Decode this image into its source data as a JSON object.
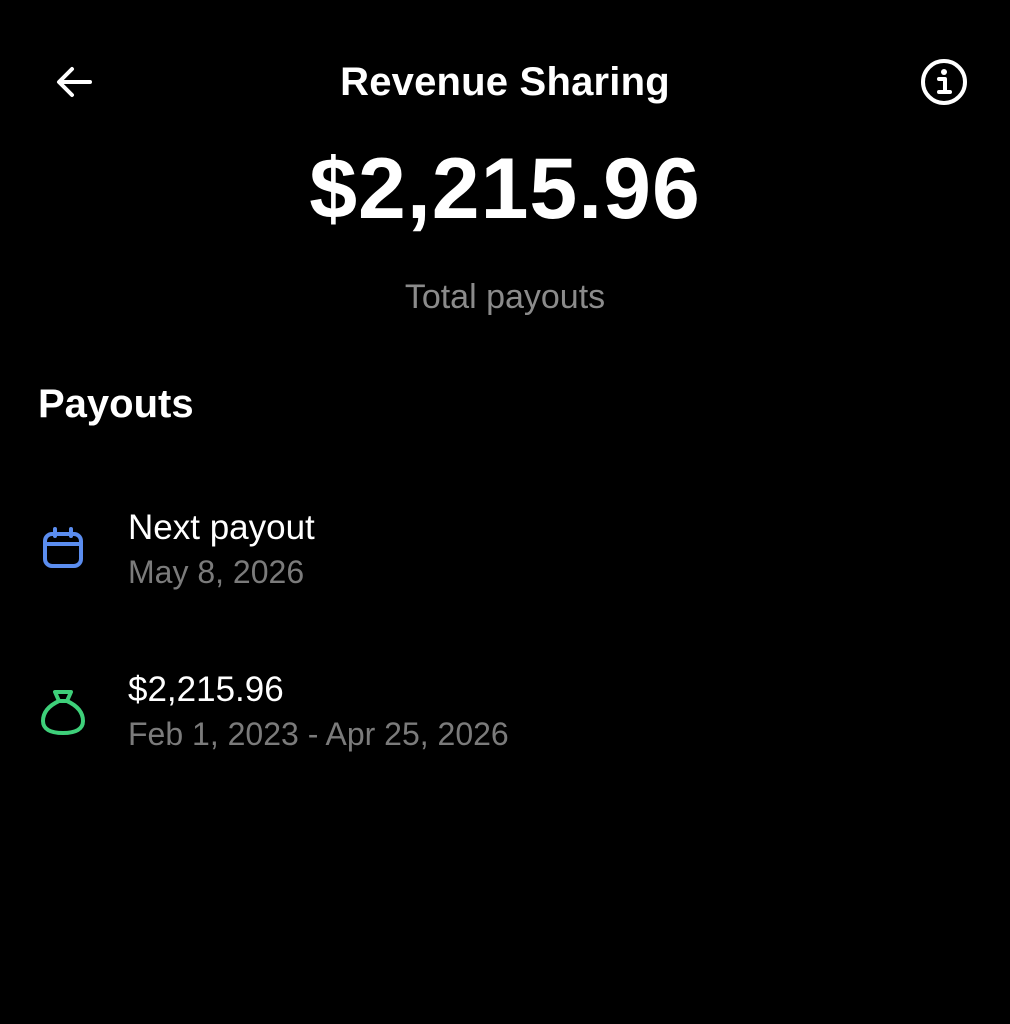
{
  "header": {
    "title": "Revenue Sharing",
    "back_icon": "arrow-left-icon",
    "info_icon": "info-circle-icon"
  },
  "summary": {
    "total_amount": "$2,215.96",
    "total_label": "Total payouts"
  },
  "payouts": {
    "heading": "Payouts",
    "items": [
      {
        "icon": "calendar-icon",
        "icon_color": "#5b8def",
        "title": "Next payout",
        "subtitle": "May 8, 2026"
      },
      {
        "icon": "money-bag-icon",
        "icon_color": "#3ed07a",
        "title": "$2,215.96",
        "subtitle": "Feb 1, 2023 - Apr 25, 2026"
      }
    ]
  },
  "colors": {
    "background": "#000000",
    "text_primary": "#ffffff",
    "text_secondary": "#7b7b7b"
  }
}
